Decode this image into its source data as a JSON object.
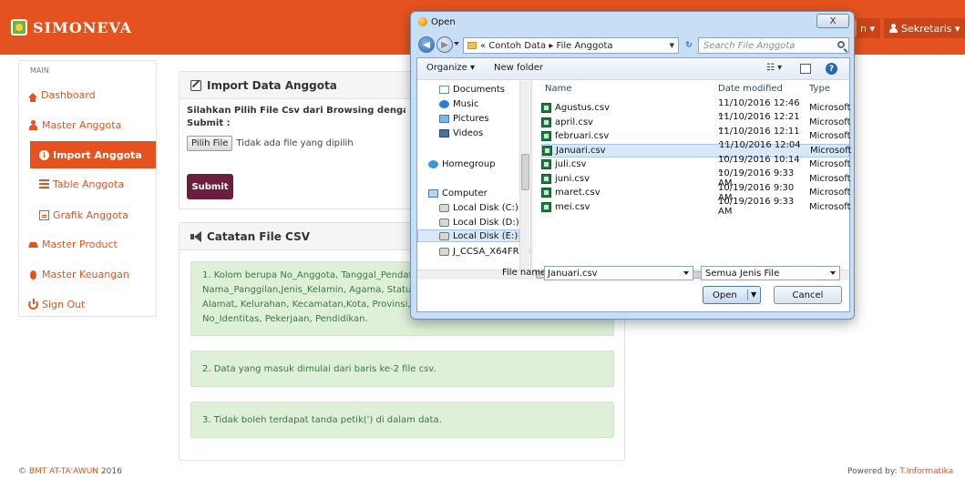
{
  "navbar": {
    "brand": "SIMONEVA",
    "user_label": "Sekretaris",
    "partial_label": "n",
    "colors": {
      "primary": "#e4531f",
      "submit": "#6b1f3f",
      "note_bg": "#dff0d8"
    }
  },
  "sidebar": {
    "header": "MAIN",
    "items": [
      {
        "label": "Dashboard",
        "icon": "home-icon"
      },
      {
        "label": "Master Anggota",
        "icon": "person-icon"
      },
      {
        "label": "Import Anggota",
        "icon": "circle-info-icon"
      },
      {
        "label": "Table Anggota",
        "icon": "list-icon"
      },
      {
        "label": "Grafik Anggota",
        "icon": "chart-icon"
      },
      {
        "label": "Master Product",
        "icon": "cart-icon"
      },
      {
        "label": "Master Keuangan",
        "icon": "fire-icon"
      },
      {
        "label": "Sign Out",
        "icon": "power-icon"
      }
    ]
  },
  "import_panel": {
    "title": "Import Data Anggota",
    "instruction_line1": "Silahkan Pilih File Csv dari Browsing dengan Mene",
    "instruction_line2": "Submit :",
    "file_button": "Pilih File",
    "file_status": "Tidak ada file yang dipilih",
    "submit_label": "Submit"
  },
  "notes_panel": {
    "title": "Catatan File CSV",
    "note1_lines": [
      "1. Kolom berupa No_Anggota, Tanggal_Pendaft",
      "Nama_Panggilan,Jenis_Kelamin, Agama, Status,",
      "Alamat, Kelurahan, Kecamatan,Kota, Provinsi, K",
      "No_Identitas, Pekerjaan, Pendidikan."
    ],
    "note2": "2. Data yang masuk dimulai dari baris ke-2 file csv.",
    "note3": "3. Tidak boleh terdapat tanda petik(') di dalam data."
  },
  "footer": {
    "left_prefix": "© ",
    "left_link": "BMT AT-TA'AWUN",
    "left_suffix": " 2016",
    "right_prefix": "Powered by: ",
    "right_link": "T.Informatika"
  },
  "dialog": {
    "title": "Open",
    "close_label": "X",
    "address": "« Contoh Data ▸ File Anggota",
    "search_placeholder": "Search File Anggota",
    "toolbar": {
      "organize": "Organize ▾",
      "new_folder": "New folder"
    },
    "tree": [
      "Documents",
      "Music",
      "Pictures",
      "Videos",
      "Homegroup",
      "Computer",
      "Local Disk (C:)",
      "Local Disk (D:)",
      "Local Disk (E:)",
      "J_CCSA_X64FRE_I"
    ],
    "columns": {
      "name": "Name",
      "date": "Date modified",
      "type": "Type"
    },
    "files": [
      {
        "name": "Agustus.csv",
        "date": "11/10/2016 12:46 ...",
        "type": "Microsoft"
      },
      {
        "name": "april.csv",
        "date": "11/10/2016 12:21 ...",
        "type": "Microsoft"
      },
      {
        "name": "februari.csv",
        "date": "11/10/2016 12:11 ...",
        "type": "Microsoft"
      },
      {
        "name": "Januari.csv",
        "date": "11/10/2016 12:04 ...",
        "type": "Microsoft"
      },
      {
        "name": "juli.csv",
        "date": "10/19/2016 10:14 ...",
        "type": "Microsoft"
      },
      {
        "name": "juni.csv",
        "date": "10/19/2016 9:33 AM",
        "type": "Microsoft"
      },
      {
        "name": "maret.csv",
        "date": "10/19/2016 9:30 AM",
        "type": "Microsoft"
      },
      {
        "name": "mei.csv",
        "date": "10/19/2016 9:33 AM",
        "type": "Microsoft"
      }
    ],
    "file_name_label": "File name:",
    "file_name_value": "Januari.csv",
    "file_type": "Semua Jenis File",
    "open_label": "Open",
    "cancel_label": "Cancel"
  }
}
